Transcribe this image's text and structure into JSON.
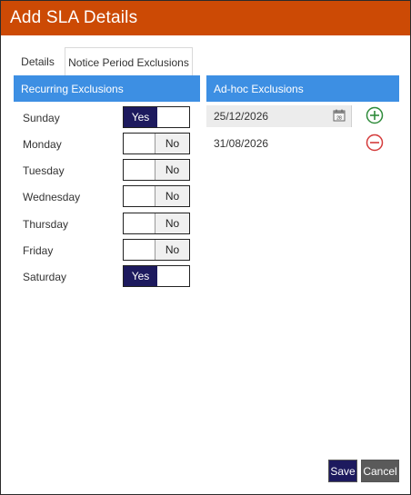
{
  "dialog": {
    "title": "Add SLA Details"
  },
  "tabs": [
    {
      "label": "Details",
      "active": false
    },
    {
      "label": "Notice Period Exclusions",
      "active": true
    }
  ],
  "recurring": {
    "header": "Recurring Exclusions",
    "days": [
      {
        "label": "Sunday",
        "value": "Yes"
      },
      {
        "label": "Monday",
        "value": "No"
      },
      {
        "label": "Tuesday",
        "value": "No"
      },
      {
        "label": "Wednesday",
        "value": "No"
      },
      {
        "label": "Thursday",
        "value": "No"
      },
      {
        "label": "Friday",
        "value": "No"
      },
      {
        "label": "Saturday",
        "value": "Yes"
      }
    ]
  },
  "adhoc": {
    "header": "Ad-hoc Exclusions",
    "input_date": "25/12/2026",
    "calendar_icon_text": "28",
    "dates": [
      "31/08/2026"
    ]
  },
  "footer": {
    "save_label": "Save",
    "cancel_label": "Cancel"
  },
  "colors": {
    "title_bar": "#cc4a05",
    "section_header": "#3d8fe3",
    "toggle_on": "#1d1a5e",
    "add": "#2e8b3a",
    "remove": "#d43a3a"
  },
  "icons": {
    "calendar": "calendar-icon",
    "add": "plus-circle-icon",
    "remove": "minus-circle-icon"
  }
}
